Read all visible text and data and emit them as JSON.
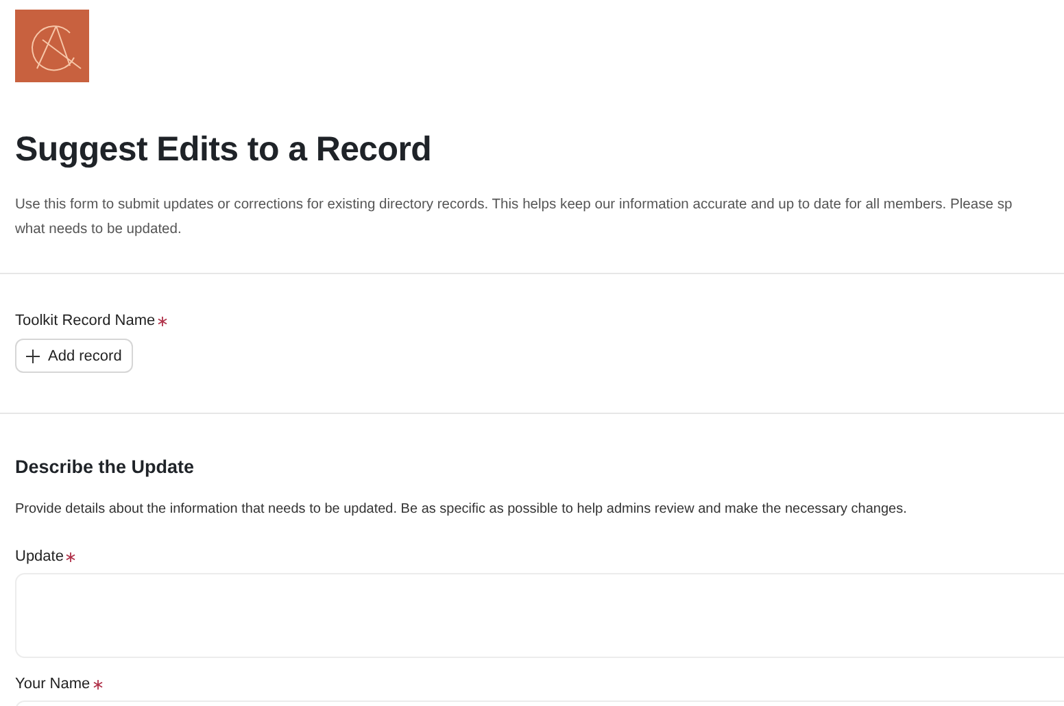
{
  "title": "Suggest Edits to a Record",
  "description_lines": [
    "Use this form to submit updates or corrections for existing directory records. This helps keep our information accurate and up to date for all members. Please sp",
    "what needs to be updated."
  ],
  "record_field": {
    "label": "Toolkit Record Name",
    "required": true,
    "button": "Add record"
  },
  "section": {
    "heading": "Describe the Update",
    "description": "Provide details about the information that needs to be updated. Be as specific as possible to help admins review and make the necessary changes."
  },
  "fields": [
    {
      "label": "Update",
      "required": true,
      "kind": "textarea"
    },
    {
      "label": "Your Name",
      "required": true,
      "kind": "text"
    }
  ]
}
